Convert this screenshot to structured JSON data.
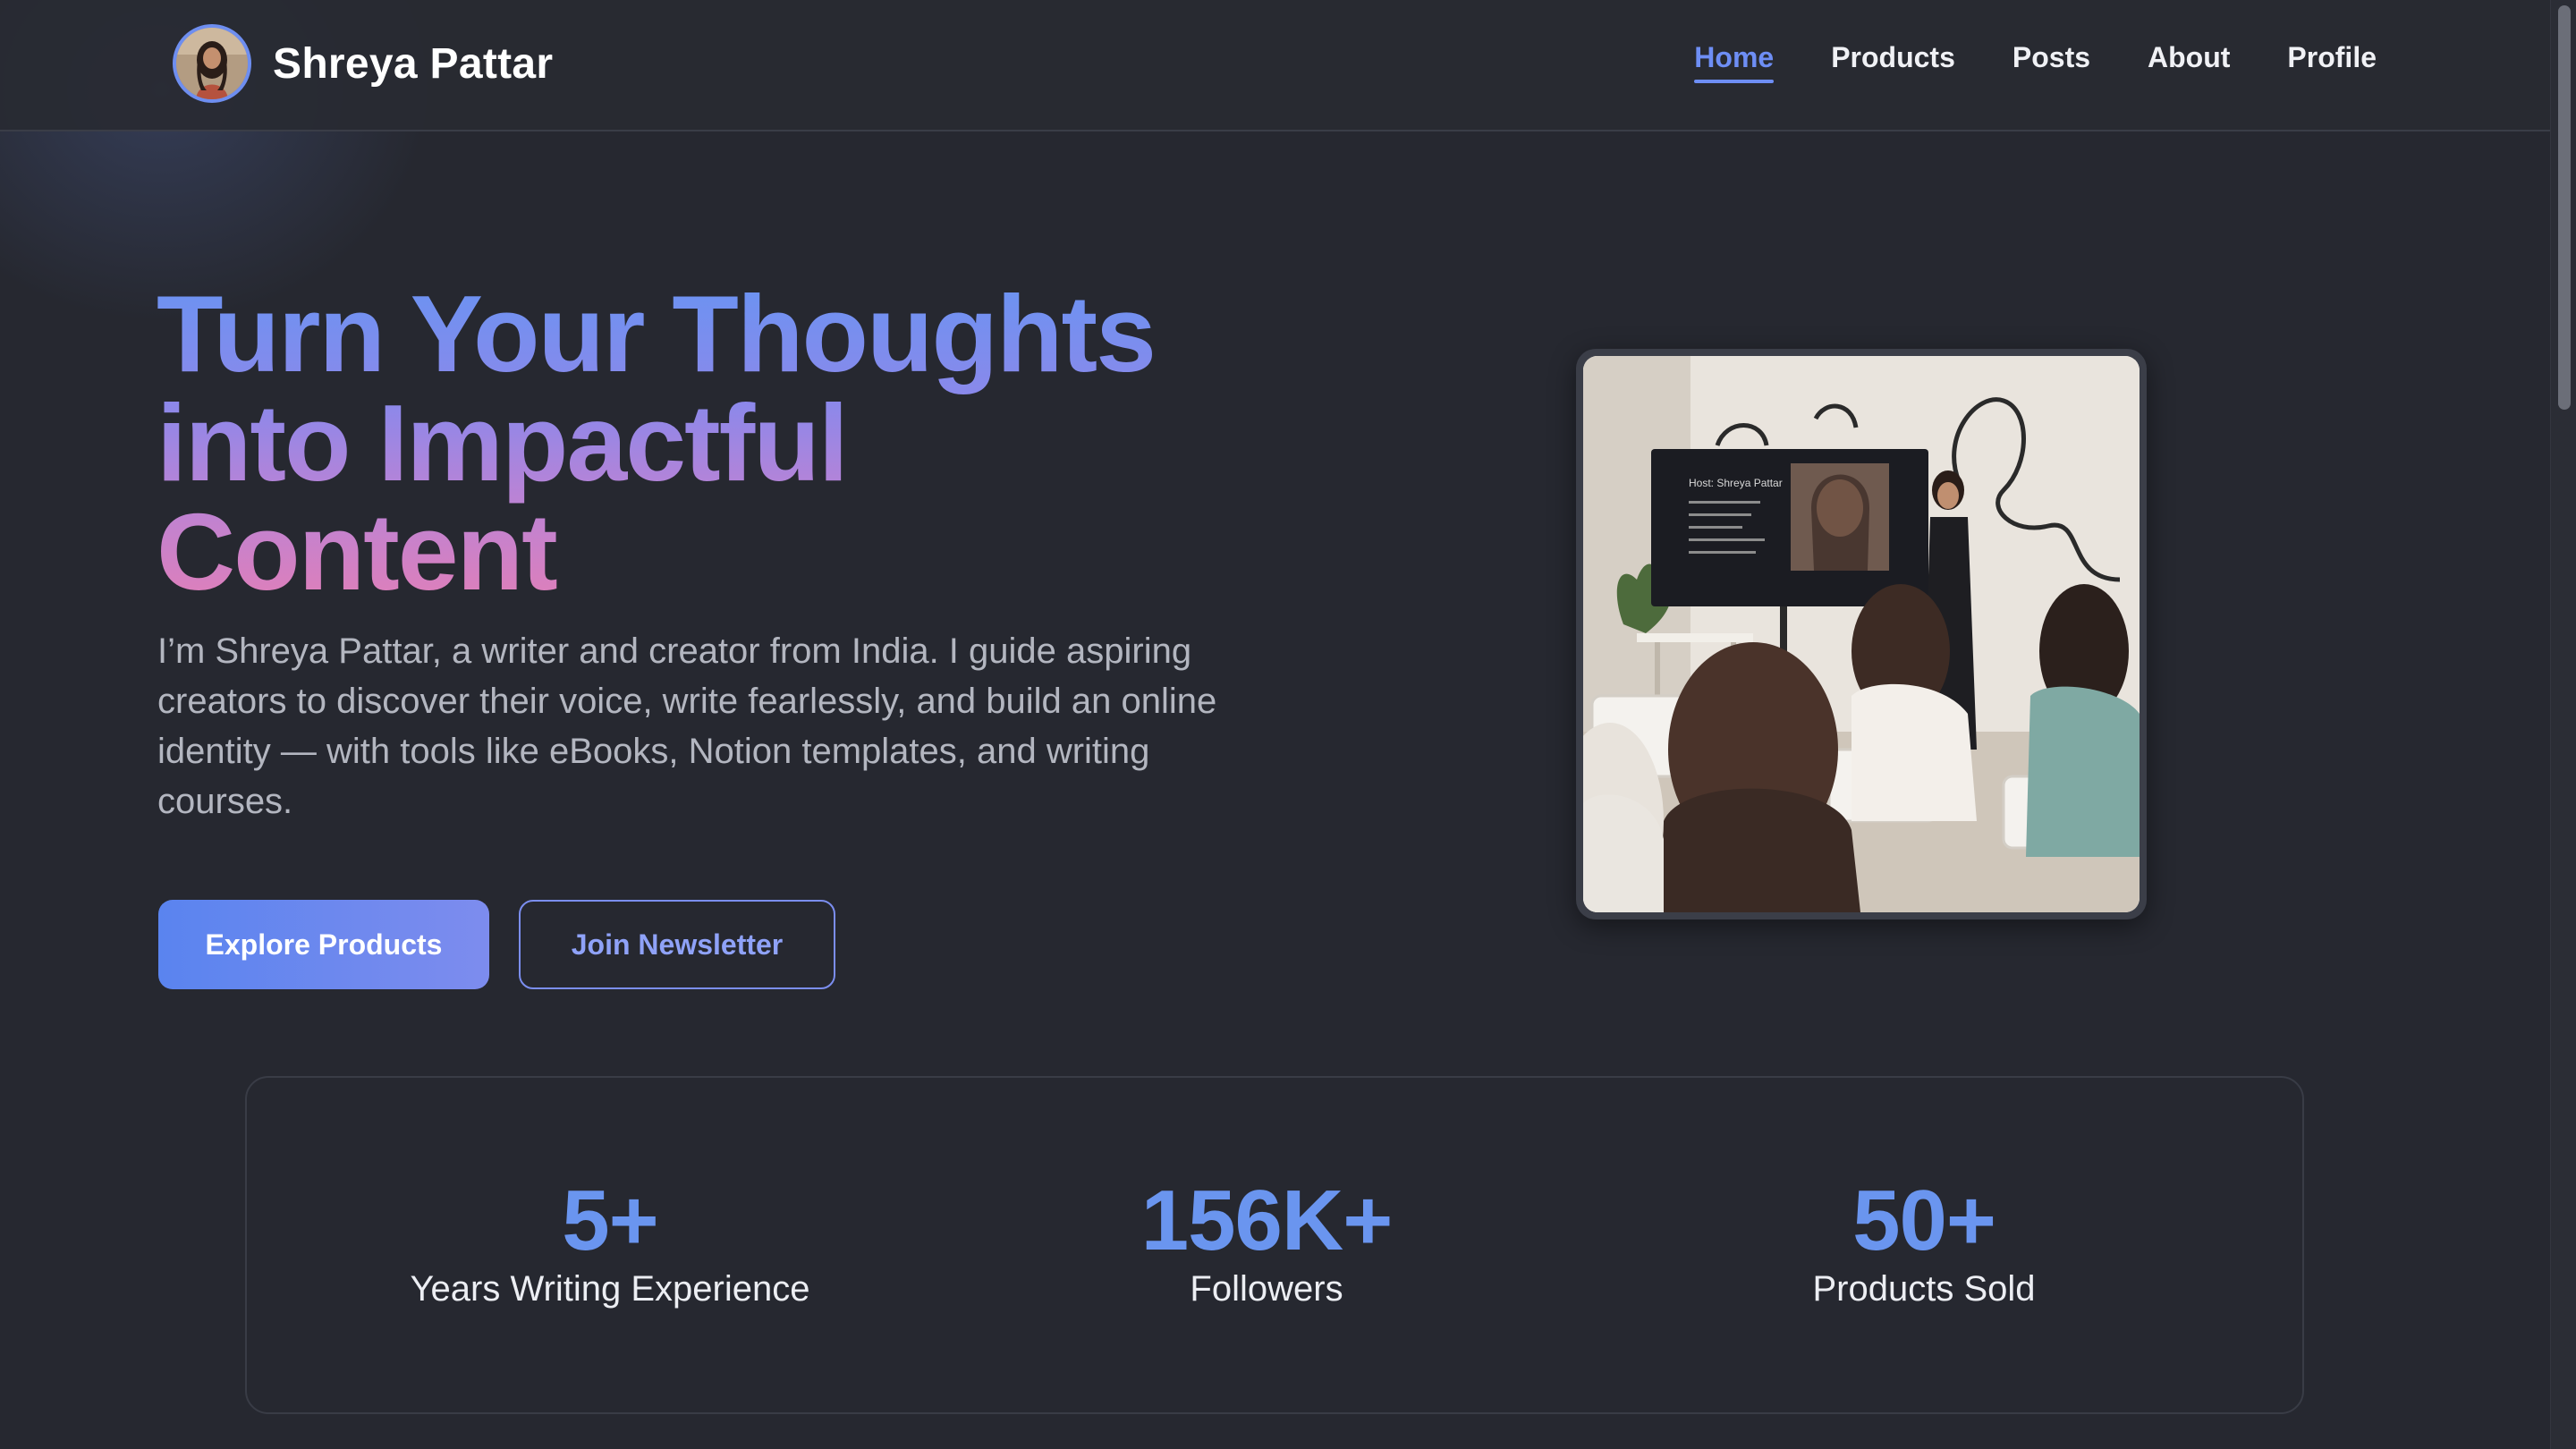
{
  "header": {
    "brand_name": "Shreya Pattar",
    "nav": [
      {
        "label": "Home",
        "active": true
      },
      {
        "label": "Products",
        "active": false
      },
      {
        "label": "Posts",
        "active": false
      },
      {
        "label": "About",
        "active": false
      },
      {
        "label": "Profile",
        "active": false
      }
    ]
  },
  "hero": {
    "title_lines": [
      "Turn Your Thoughts",
      "into Impactful",
      "Content"
    ],
    "description": "I’m Shreya Pattar, a writer and creator from India. I guide aspiring creators to discover their voice, write fearlessly, and build an online identity — with tools like eBooks, Notion templates, and writing courses.",
    "primary_button": "Explore Products",
    "secondary_button": "Join Newsletter"
  },
  "photo": {
    "screen_host": "Host: Shreya Pattar"
  },
  "stats": [
    {
      "value": "5+",
      "label": "Years Writing Experience"
    },
    {
      "value": "156K+",
      "label": "Followers"
    },
    {
      "value": "50+",
      "label": "Products Sold"
    }
  ],
  "colors": {
    "accent": "#6e8ef5",
    "background": "#262830",
    "stat_value": "#6a95ef",
    "title_gradient_start": "#6a93f2",
    "title_gradient_end": "#e07fb9"
  },
  "icons": {
    "avatar": "profile-photo",
    "hero_image": "workshop-photo"
  }
}
